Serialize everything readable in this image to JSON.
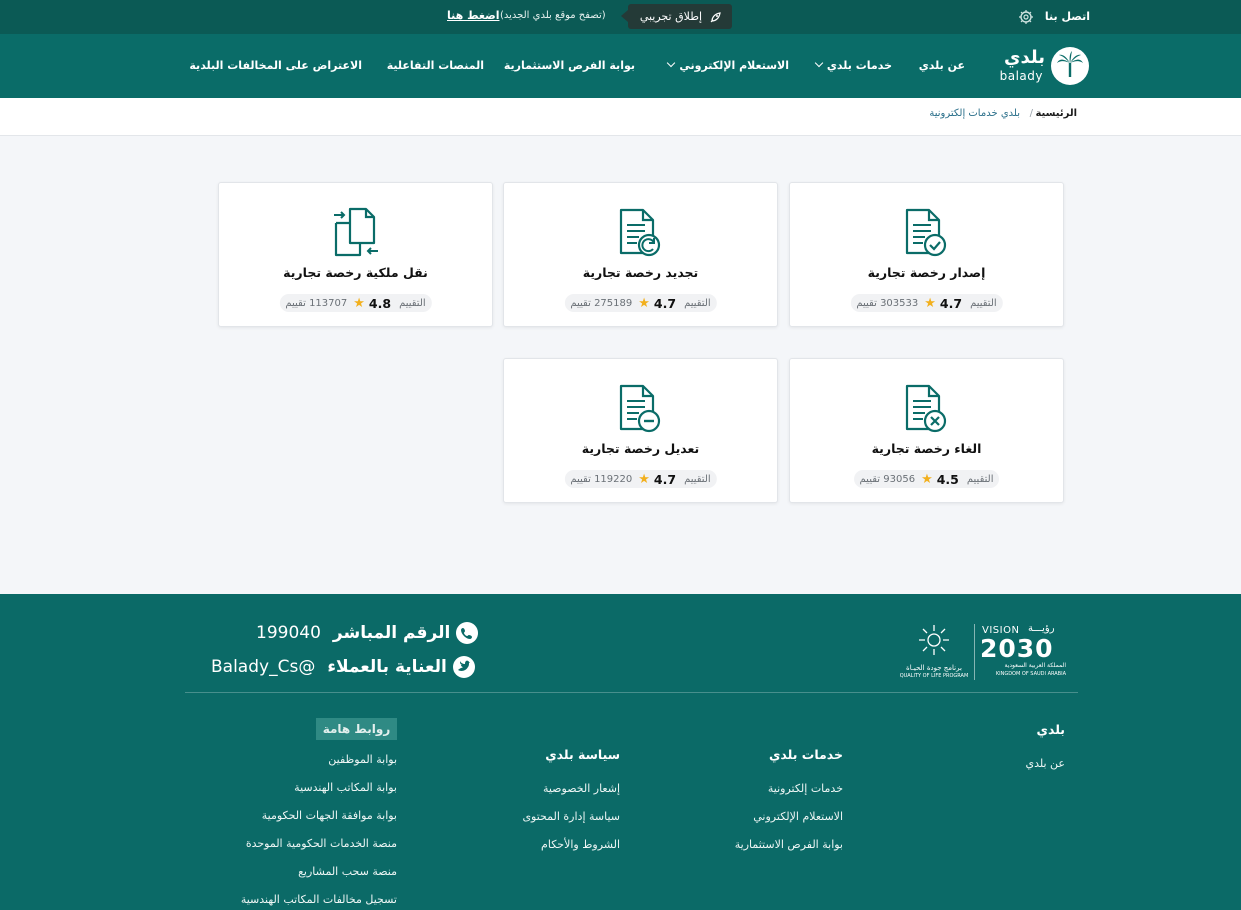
{
  "topbar": {
    "contact": "اتصل بنا",
    "beta_label": "إطلاق تجريبي",
    "beta_note": "(تصفح موقع بلدي الجديد)",
    "beta_link": "اضغط هنا"
  },
  "nav": {
    "logo_ar": "بلدي",
    "logo_en": "balady",
    "items": [
      {
        "label": "عن بلدي"
      },
      {
        "label": "خدمات بلدي"
      },
      {
        "label": "الاستعلام الإلكتروني"
      },
      {
        "label": "بوابة الفرص الاستثمارية"
      },
      {
        "label": "المنصات التفاعلية"
      },
      {
        "label": "الاعتراض على المخالفات البلدية"
      }
    ]
  },
  "breadcrumb": {
    "home": "الرئيسية",
    "separator": "/",
    "current": "بلدي خدمات إلكترونية"
  },
  "cards": [
    {
      "title": "إصدار رخصة تجارية",
      "rating_label": "التقييم",
      "rating": "4.7",
      "count": "303533 تقييم",
      "icon": "document-check-icon"
    },
    {
      "title": "تجديد رخصة تجارية",
      "rating_label": "التقييم",
      "rating": "4.7",
      "count": "275189 تقييم",
      "icon": "document-renew-icon"
    },
    {
      "title": "نقل ملكية رخصة تجارية",
      "rating_label": "التقييم",
      "rating": "4.8",
      "count": "113707 تقييم",
      "icon": "document-transfer-icon"
    },
    {
      "title": "الغاء رخصة تجارية",
      "rating_label": "التقييم",
      "rating": "4.5",
      "count": "93056 تقييم",
      "icon": "document-cancel-icon"
    },
    {
      "title": "تعديل رخصة تجارية",
      "rating_label": "التقييم",
      "rating": "4.7",
      "count": "119220 تقييم",
      "icon": "document-minus-icon"
    }
  ],
  "footer": {
    "hotline_label": "الرقم المباشر",
    "hotline_value": "199040",
    "care_label": "العناية بالعملاء",
    "care_value": "@Balady_Cs",
    "vision_label": "VISION",
    "vision_ar": "رؤيـــة",
    "vision_year": "2030",
    "vision_kingdom_ar": "المملكة العربية السعودية",
    "vision_kingdom_en": "KINGDOM OF SAUDI ARABIA",
    "qol_ar": "برنامج جودة الحيـاة",
    "qol_en": "QUALITY OF LIFE PROGRAM",
    "col_balady": {
      "heading": "بلدي",
      "links": [
        "عن بلدي"
      ]
    },
    "col_services": {
      "heading": "خدمات بلدي",
      "links": [
        "خدمات إلكترونية",
        "الاستعلام الإلكتروني",
        "بوابة الفرص الاستثمارية"
      ]
    },
    "col_policy": {
      "heading": "سياسة بلدي",
      "links": [
        "إشعار الخصوصية",
        "سياسة إدارة المحتوى",
        "الشروط والأحكام"
      ]
    },
    "col_important": {
      "heading": "روابط هامة",
      "links": [
        "بوابة الموظفين",
        "بوابة المكاتب الهندسية",
        "بوابة موافقة الجهات الحكومية",
        "منصة الخدمات الحكومية الموحدة",
        "منصة سحب المشاريع",
        "تسجيل مخالفات المكاتب الهندسية"
      ]
    }
  },
  "colors": {
    "topbar": "#0b5a55",
    "nav": "#0a6c68",
    "footer": "#0b6a67",
    "accent": "#0a6c68",
    "star": "#f2b01e"
  }
}
